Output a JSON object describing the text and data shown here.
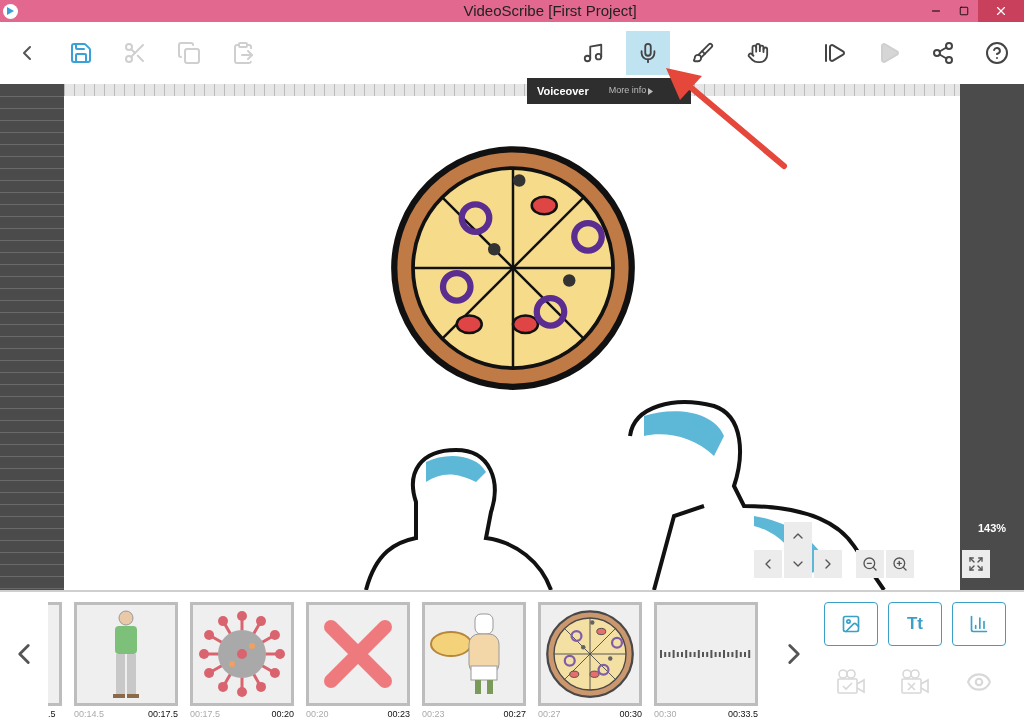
{
  "window": {
    "title": "VideoScribe [First Project]"
  },
  "toolbar": {
    "left": [
      {
        "kind": "back",
        "disabled": false
      },
      {
        "kind": "save",
        "disabled": false
      },
      {
        "kind": "cut",
        "disabled": true
      },
      {
        "kind": "copy",
        "disabled": true
      },
      {
        "kind": "paste",
        "disabled": true
      }
    ],
    "modes": [
      {
        "kind": "music",
        "selected": false
      },
      {
        "kind": "voiceover",
        "selected": true
      },
      {
        "kind": "brush",
        "selected": false
      },
      {
        "kind": "hand",
        "selected": false
      }
    ],
    "right": [
      {
        "kind": "play-from",
        "disabled": false
      },
      {
        "kind": "play",
        "disabled": true
      },
      {
        "kind": "share",
        "disabled": false
      },
      {
        "kind": "help",
        "disabled": false
      }
    ]
  },
  "tooltip": {
    "title": "Voiceover",
    "link": "More info"
  },
  "zoom": {
    "reading": "143%"
  },
  "timeline": {
    "partial_end": ".5",
    "items": [
      {
        "kind": "person",
        "start": "00:14.5",
        "end": "00:17.5"
      },
      {
        "kind": "virus",
        "start": "00:17.5",
        "end": "00:20"
      },
      {
        "kind": "cross",
        "start": "00:20",
        "end": "00:23"
      },
      {
        "kind": "chef",
        "start": "00:23",
        "end": "00:27"
      },
      {
        "kind": "pizza",
        "start": "00:27",
        "end": "00:30"
      },
      {
        "kind": "text",
        "start": "00:30",
        "end": "00:33.5"
      }
    ]
  },
  "add_buttons": [
    {
      "kind": "image"
    },
    {
      "kind": "text",
      "label": "Tt"
    },
    {
      "kind": "chart"
    }
  ],
  "camera_buttons": [
    {
      "kind": "set-camera",
      "disabled": true
    },
    {
      "kind": "clear-camera",
      "disabled": true
    },
    {
      "kind": "preview",
      "disabled": true
    }
  ]
}
